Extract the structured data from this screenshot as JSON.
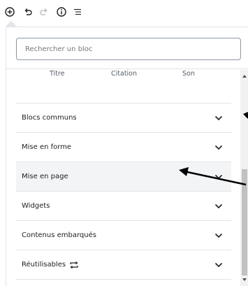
{
  "search": {
    "placeholder": "Rechercher un bloc"
  },
  "block_types": [
    "Titre",
    "Citation",
    "Son"
  ],
  "panels": [
    {
      "label": "Blocs communs"
    },
    {
      "label": "Mise en forme"
    },
    {
      "label": "Mise en page"
    },
    {
      "label": "Widgets"
    },
    {
      "label": "Contenus embarqués"
    },
    {
      "label": "Réutilisables"
    }
  ],
  "icons": {
    "toolbar": [
      "add-block-icon",
      "undo-icon",
      "redo-icon",
      "info-icon",
      "outline-icon"
    ],
    "panel": "chevron-down-icon",
    "reusable": "reusable-icon"
  },
  "colors": {
    "text": "#1e1e1e",
    "border": "#e2e4e7",
    "hover": "#f3f4f5",
    "muted": "#555d66"
  }
}
